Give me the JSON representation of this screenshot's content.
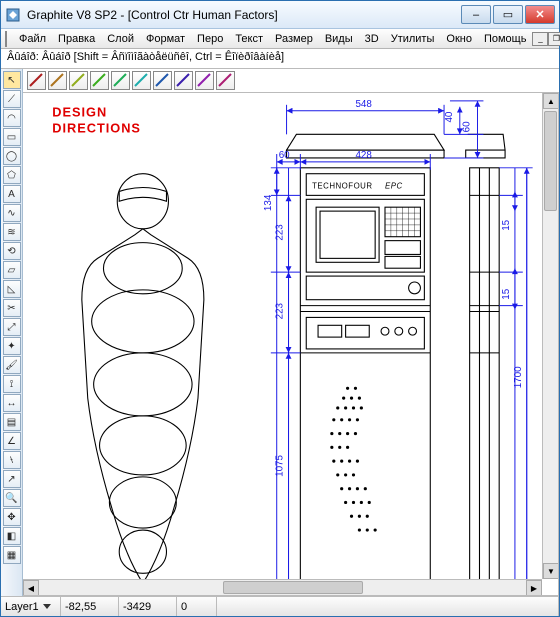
{
  "window": {
    "title": "Graphite V8 SP2 - [Control Ctr Human Factors]",
    "min_label": "–",
    "max_label": "▭",
    "close_label": "✕"
  },
  "menu": {
    "items": [
      {
        "label": "Файл"
      },
      {
        "label": "Правка"
      },
      {
        "label": "Слой"
      },
      {
        "label": "Формат"
      },
      {
        "label": "Перо"
      },
      {
        "label": "Текст"
      },
      {
        "label": "Размер"
      },
      {
        "label": "Виды"
      },
      {
        "label": "3D"
      },
      {
        "label": "Утилиты"
      },
      {
        "label": "Окно"
      },
      {
        "label": "Помощь"
      }
    ],
    "mdi_min": "_",
    "mdi_max": "❐",
    "mdi_close": "×"
  },
  "hint": "Âûáîð: Âûáîð  [Shift = Âñïîìîãàòåëüñêî, Ctrl = Êîïèðîâàíèå]",
  "toolbar_left": [
    {
      "name": "cursor-icon",
      "glyph": "↖"
    },
    {
      "name": "line-icon",
      "glyph": "⟋"
    },
    {
      "name": "arc-icon",
      "glyph": "◠"
    },
    {
      "name": "rect-icon",
      "glyph": "▭"
    },
    {
      "name": "circle-icon",
      "glyph": "◯"
    },
    {
      "name": "polygon-icon",
      "glyph": "⬠"
    },
    {
      "name": "text-icon",
      "glyph": "A"
    },
    {
      "name": "curve-icon",
      "glyph": "∿"
    },
    {
      "name": "offset-icon",
      "glyph": "≋"
    },
    {
      "name": "rev-icon",
      "glyph": "⟲"
    },
    {
      "name": "fillet-icon",
      "glyph": "▱"
    },
    {
      "name": "chamfer-icon",
      "glyph": "◺"
    },
    {
      "name": "trim-icon",
      "glyph": "✂"
    },
    {
      "name": "scale-icon",
      "glyph": "⤢"
    },
    {
      "name": "snap-icon",
      "glyph": "✦"
    },
    {
      "name": "paint-icon",
      "glyph": "🖌"
    },
    {
      "name": "measure-icon",
      "glyph": "⟟"
    },
    {
      "name": "dim-icon",
      "glyph": "↔"
    },
    {
      "name": "hatch-icon",
      "glyph": "▤"
    },
    {
      "name": "angle-icon",
      "glyph": "∠"
    },
    {
      "name": "break-icon",
      "glyph": "⧷"
    },
    {
      "name": "extend-icon",
      "glyph": "↗"
    },
    {
      "name": "zoom-icon",
      "glyph": "🔍"
    },
    {
      "name": "pan-icon",
      "glyph": "✥"
    },
    {
      "name": "view-icon",
      "glyph": "◧"
    },
    {
      "name": "layer-icon",
      "glyph": "▦"
    }
  ],
  "pen_toolbar_count": 10,
  "drawing": {
    "header_left": "DESIGN",
    "header_left2": "DIRECTIONS",
    "panel_brand": "TECHNOFOUR",
    "panel_model": "EPC",
    "dims": {
      "top_width": "548",
      "top_right_40": "40",
      "top_right_60": "60",
      "left_60": "60",
      "center_428": "428",
      "left_134": "134",
      "left_223a": "223",
      "left_223b": "223",
      "left_1075": "1075",
      "right_15a": "15",
      "right_15b": "15",
      "right_1700": "1700"
    }
  },
  "status": {
    "layer_label": "Layer1",
    "x_value": "-82,55",
    "y_value": "-3429",
    "z_value": "0",
    "empty": ""
  }
}
